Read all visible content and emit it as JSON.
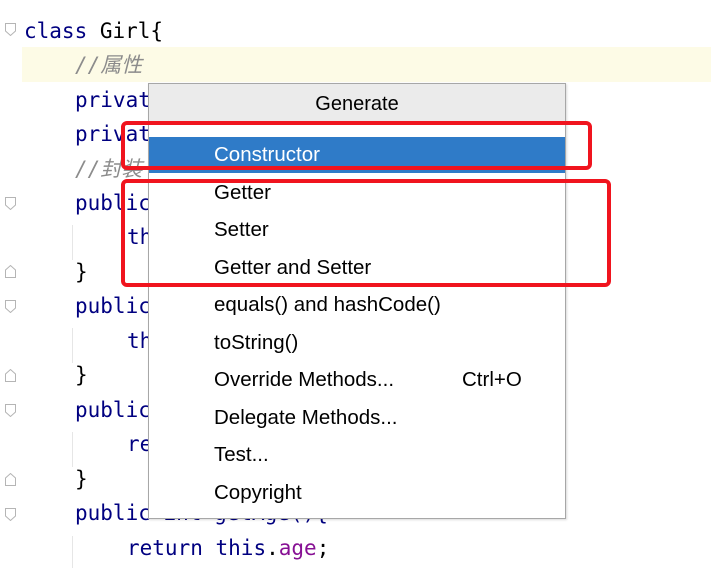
{
  "editor": {
    "lines": [
      {
        "parts": [
          {
            "t": "class ",
            "c": "kw"
          },
          {
            "t": "Girl{",
            "c": "plain"
          }
        ]
      },
      {
        "parts": [
          {
            "t": "//属性",
            "c": "comment"
          }
        ]
      },
      {
        "parts": [
          {
            "t": "privat",
            "c": "kw"
          }
        ]
      },
      {
        "parts": [
          {
            "t": "privat",
            "c": "kw"
          }
        ]
      },
      {
        "parts": [
          {
            "t": "//封装",
            "c": "comment"
          }
        ]
      },
      {
        "parts": [
          {
            "t": "public",
            "c": "kw"
          }
        ]
      },
      {
        "parts": [
          {
            "t": "th",
            "c": "kw"
          }
        ]
      },
      {
        "parts": [
          {
            "t": "}",
            "c": "plain"
          }
        ]
      },
      {
        "parts": [
          {
            "t": "public",
            "c": "kw"
          }
        ]
      },
      {
        "parts": [
          {
            "t": "th",
            "c": "kw"
          }
        ]
      },
      {
        "parts": [
          {
            "t": "}",
            "c": "plain"
          }
        ]
      },
      {
        "parts": [
          {
            "t": "public",
            "c": "kw"
          }
        ]
      },
      {
        "parts": [
          {
            "t": "re",
            "c": "kw"
          }
        ]
      },
      {
        "parts": [
          {
            "t": "}",
            "c": "plain"
          }
        ]
      },
      {
        "parts": [
          {
            "t": "public int getAge(){",
            "c": "kw"
          }
        ]
      },
      {
        "parts": [
          {
            "t": "return ",
            "c": "kw"
          },
          {
            "t": "this",
            "c": "kw"
          },
          {
            "t": ".",
            "c": "plain"
          },
          {
            "t": "age",
            "c": "field"
          },
          {
            "t": ";",
            "c": "plain"
          }
        ]
      }
    ]
  },
  "popup": {
    "title": "Generate",
    "items": [
      {
        "label": "Constructor",
        "shortcut": "",
        "selected": true
      },
      {
        "label": "Getter",
        "shortcut": ""
      },
      {
        "label": "Setter",
        "shortcut": ""
      },
      {
        "label": "Getter and Setter",
        "shortcut": ""
      },
      {
        "label": "equals() and hashCode()",
        "shortcut": ""
      },
      {
        "label": "toString()",
        "shortcut": ""
      },
      {
        "label": "Override Methods...",
        "shortcut": "Ctrl+O"
      },
      {
        "label": "Delegate Methods...",
        "shortcut": ""
      },
      {
        "label": "Test...",
        "shortcut": ""
      },
      {
        "label": "Copyright",
        "shortcut": ""
      }
    ]
  },
  "colors": {
    "keyword": "#000080",
    "field": "#871094",
    "comment": "#8c8c8c",
    "selection": "#2f7bc8",
    "annotation": "#f0141e"
  }
}
